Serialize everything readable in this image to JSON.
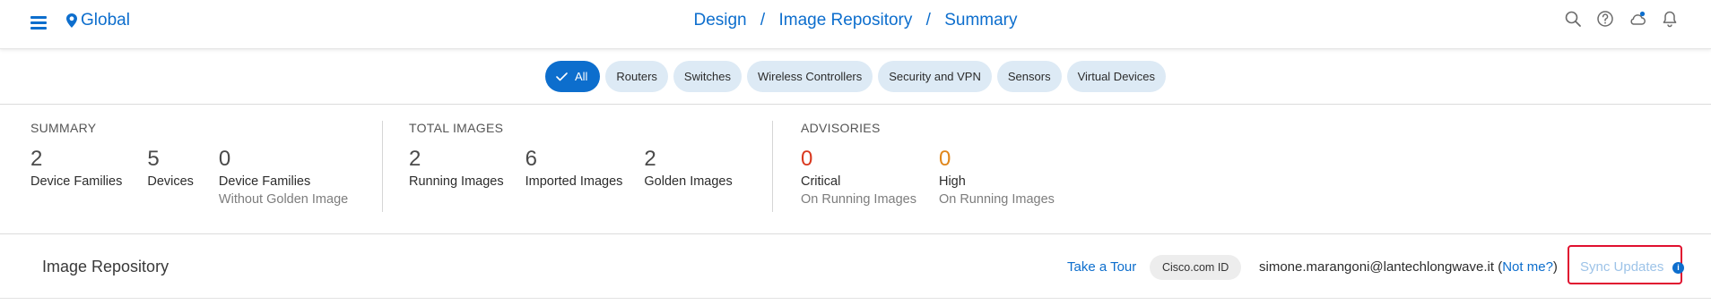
{
  "header": {
    "location": "Global",
    "breadcrumb": [
      "Design",
      "Image Repository",
      "Summary"
    ],
    "breadcrumb_separator": "/",
    "icons": [
      "search-icon",
      "help-icon",
      "cloud-icon",
      "bell-icon"
    ]
  },
  "filters": {
    "items": [
      "All",
      "Routers",
      "Switches",
      "Wireless Controllers",
      "Security and VPN",
      "Sensors",
      "Virtual Devices"
    ],
    "selected": "All"
  },
  "summary": {
    "title": "SUMMARY",
    "stats": [
      {
        "value": "2",
        "label": "Device Families",
        "sub": ""
      },
      {
        "value": "5",
        "label": "Devices",
        "sub": ""
      },
      {
        "value": "0",
        "label": "Device Families",
        "sub": "Without Golden Image"
      }
    ]
  },
  "total_images": {
    "title": "TOTAL IMAGES",
    "stats": [
      {
        "value": "2",
        "label": "Running Images"
      },
      {
        "value": "6",
        "label": "Imported Images"
      },
      {
        "value": "2",
        "label": "Golden Images"
      }
    ]
  },
  "advisories": {
    "title": "ADVISORIES",
    "stats": [
      {
        "value": "0",
        "label": "Critical",
        "sub": "On Running Images",
        "color": "#d9381e"
      },
      {
        "value": "0",
        "label": "High",
        "sub": "On Running Images",
        "color": "#e0861a"
      }
    ]
  },
  "repository": {
    "title": "Image Repository",
    "take_tour": "Take a Tour",
    "cco_badge": "Cisco.com ID",
    "user": "simone.marangoni@lantechlongwave.it",
    "not_me_open": "(",
    "not_me": "Not me?",
    "not_me_close": ")",
    "sync": "Sync Updates",
    "sync_info": "i"
  },
  "colors": {
    "accent": "#0d6ecd",
    "highlight_box": "#e0102f"
  }
}
